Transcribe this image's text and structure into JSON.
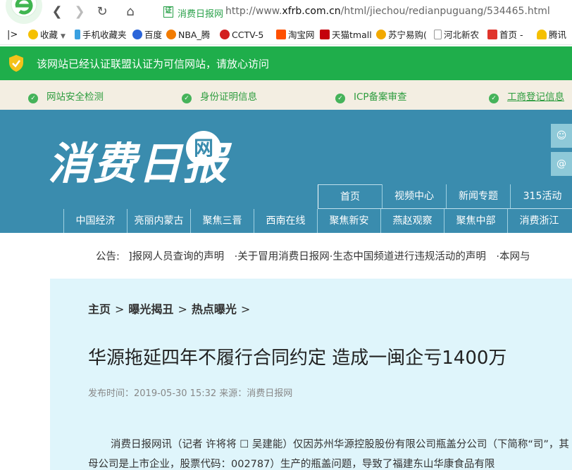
{
  "browser": {
    "url_site_name": "消费日报网",
    "url_prefix": "http://www.",
    "url_domain": "xfrb.com.cn",
    "url_path": "/html/jiechou/redianpuguang/534465.html",
    "url_badge": "证"
  },
  "bookmarks": [
    {
      "label": "收藏",
      "color": "#f5c000"
    },
    {
      "label": "手机收藏夹",
      "color": "#3aa0e0"
    },
    {
      "label": "百度",
      "color": "#2b65d9"
    },
    {
      "label": "NBA_腾",
      "color": "#f27b00"
    },
    {
      "label": "CCTV-5",
      "color": "#d21f1f"
    },
    {
      "label": "淘宝网",
      "color": "#ff5000"
    },
    {
      "label": "天猫tmall",
      "color": "#c4000c"
    },
    {
      "label": "苏宁易购(",
      "color": "#f2a900"
    },
    {
      "label": "河北新农",
      "color": "#999999"
    },
    {
      "label": "首页 -",
      "color": "#e0342b"
    },
    {
      "label": "腾讯",
      "color": "#f5c000"
    }
  ],
  "trust_bar": {
    "text": "该网站已经认证联盟认证为可信网站，请放心访问"
  },
  "verify": {
    "items": [
      "网站安全检测",
      "身份证明信息",
      "ICP备案审查",
      "工商登记信息"
    ]
  },
  "header": {
    "logo_text": "消费日报",
    "logo_badge": "网",
    "nav_top": [
      "首页",
      "视频中心",
      "新闻专题",
      "315活动"
    ],
    "nav_bottom": [
      "中国经济",
      "亮丽内蒙古",
      "聚焦三晋",
      "西南在线",
      "聚焦新安",
      "燕赵观察",
      "聚焦中部",
      "消费浙江"
    ]
  },
  "notice": {
    "label": "公告:",
    "text": "]报网人员查询的声明　·关于冒用消费日报网·生态中国频道进行违规活动的声明　·本网与"
  },
  "article": {
    "crumbs": [
      "主页",
      "曝光揭丑",
      "热点曝光"
    ],
    "crumb_sep": ">",
    "title": "华源拖延四年不履行合同约定 造成一闽企亏1400万",
    "meta": "发布时间：2019-05-30 15:32  来源：消费日报网",
    "paragraph": "消费日报网讯（记者 许将将 ☐ 吴建能）仅因苏州华源控股股份有限公司瓶盖分公司（下简称“司”，其母公司是上市企业，股票代码：002787）生产的瓶盖问题，导致了福建东山华康食品有限"
  }
}
